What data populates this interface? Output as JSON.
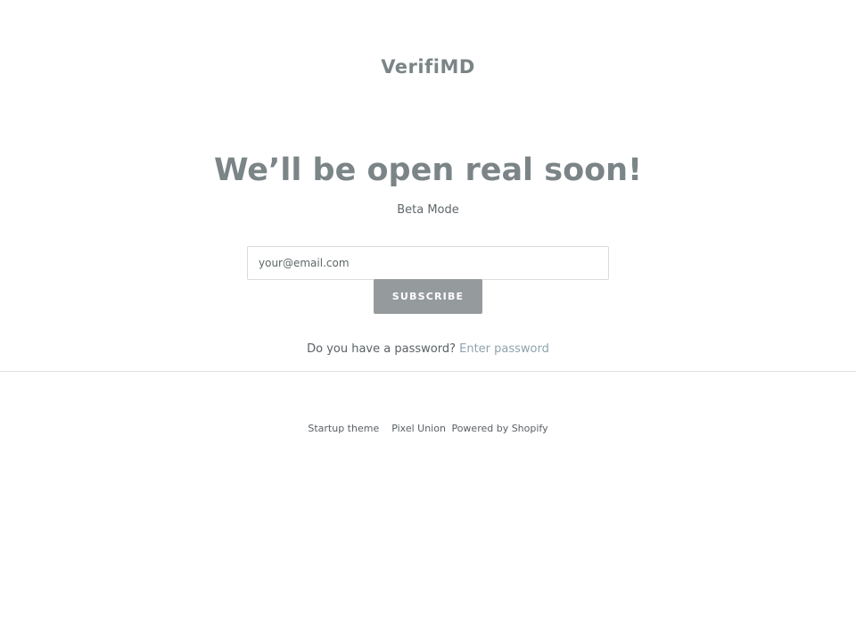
{
  "header": {
    "brand": "VerifiMD"
  },
  "main": {
    "headline": "We’ll be open real soon!",
    "subtitle": "Beta Mode",
    "email_placeholder": "your@email.com",
    "subscribe_label": "SUBSCRIBE",
    "password_prompt": "Do you have a password?",
    "password_link": "Enter password"
  },
  "footer": {
    "theme_link": "Startup theme",
    "author_link": "Pixel Union",
    "powered_link": "Powered by Shopify"
  },
  "colors": {
    "heading": "#7b8486",
    "button": "#959a9c",
    "link": "#8fa3ad",
    "divider": "#dcdfe0"
  }
}
